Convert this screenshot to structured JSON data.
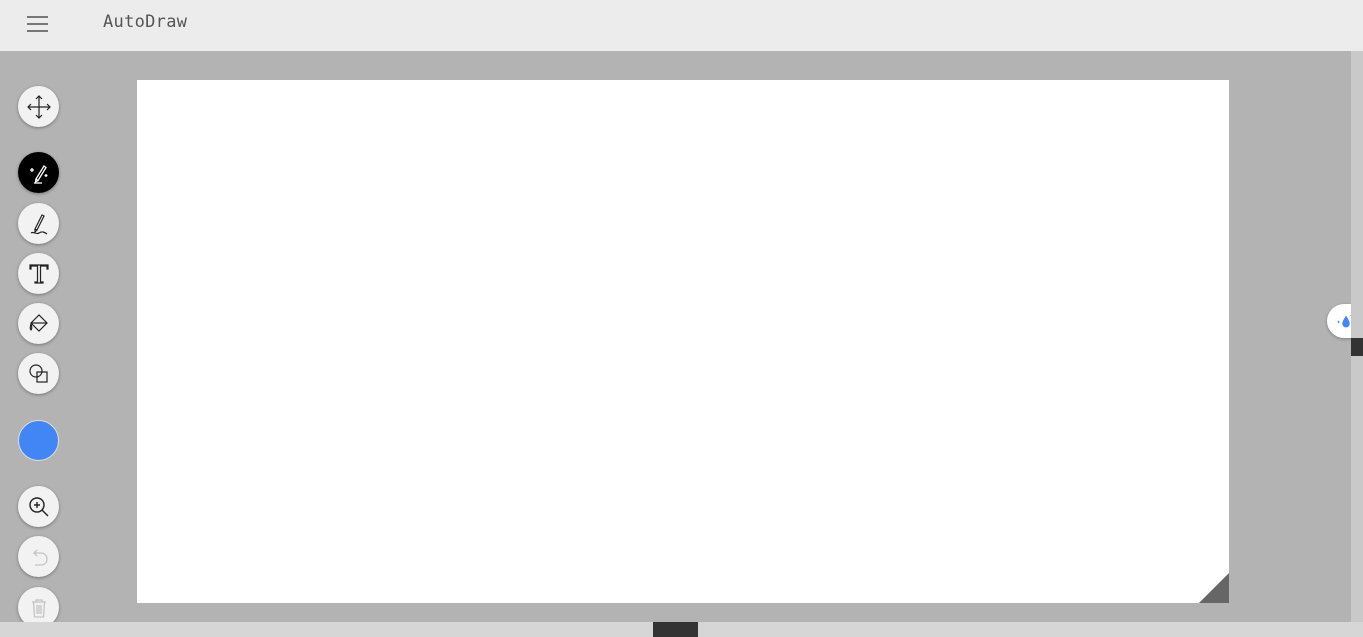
{
  "header": {
    "menu_icon": "hamburger-menu-icon",
    "title": "AutoDraw"
  },
  "toolbar": {
    "tools": [
      {
        "name": "select",
        "icon": "move-arrows-icon",
        "active": false
      },
      {
        "name": "autodraw",
        "icon": "magic-pen-icon",
        "active": true
      },
      {
        "name": "draw",
        "icon": "pen-icon",
        "active": false
      },
      {
        "name": "type",
        "icon": "text-icon",
        "active": false
      },
      {
        "name": "fill",
        "icon": "paint-bucket-icon",
        "active": false
      },
      {
        "name": "shape",
        "icon": "shapes-icon",
        "active": false
      }
    ],
    "color": "#4285f4",
    "zoom_icon": "zoom-in-icon",
    "undo_icon": "undo-icon",
    "delete_icon": "trash-icon"
  },
  "side_button": {
    "icon": "sparkle-drop-icon",
    "accent": "#4285f4"
  }
}
